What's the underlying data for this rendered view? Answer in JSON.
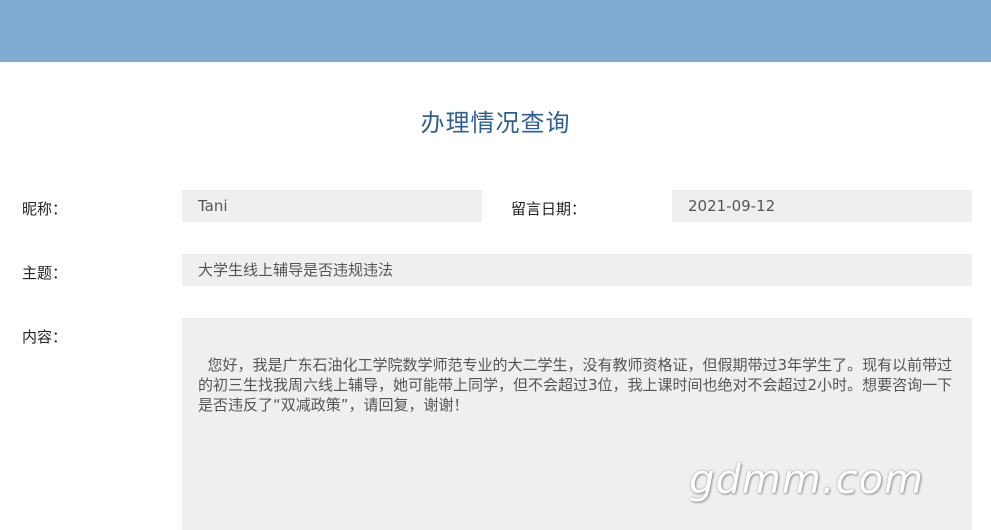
{
  "header": {
    "title": "办理情况查询"
  },
  "form": {
    "nickname_label": "昵称：",
    "nickname_value": "Tani",
    "date_label": "留言日期：",
    "date_value": "2021-09-12",
    "subject_label": "主题：",
    "subject_value": "大学生线上辅导是否违规违法",
    "content_label": "内容：",
    "content_value": "您好，我是广东石油化工学院数学师范专业的大二学生，没有教师资格证，但假期带过3年学生了。现有以前带过的初三生找我周六线上辅导，她可能带上同学，但不会超过3位，我上课时间也绝对不会超过2小时。想要咨询一下是否违反了“双减政策”，请回复，谢谢！"
  },
  "watermark": {
    "text": "gdmm.com"
  },
  "colors": {
    "header_band": "#82abd1",
    "title": "#2f5f93",
    "field_bg": "#efefef"
  }
}
